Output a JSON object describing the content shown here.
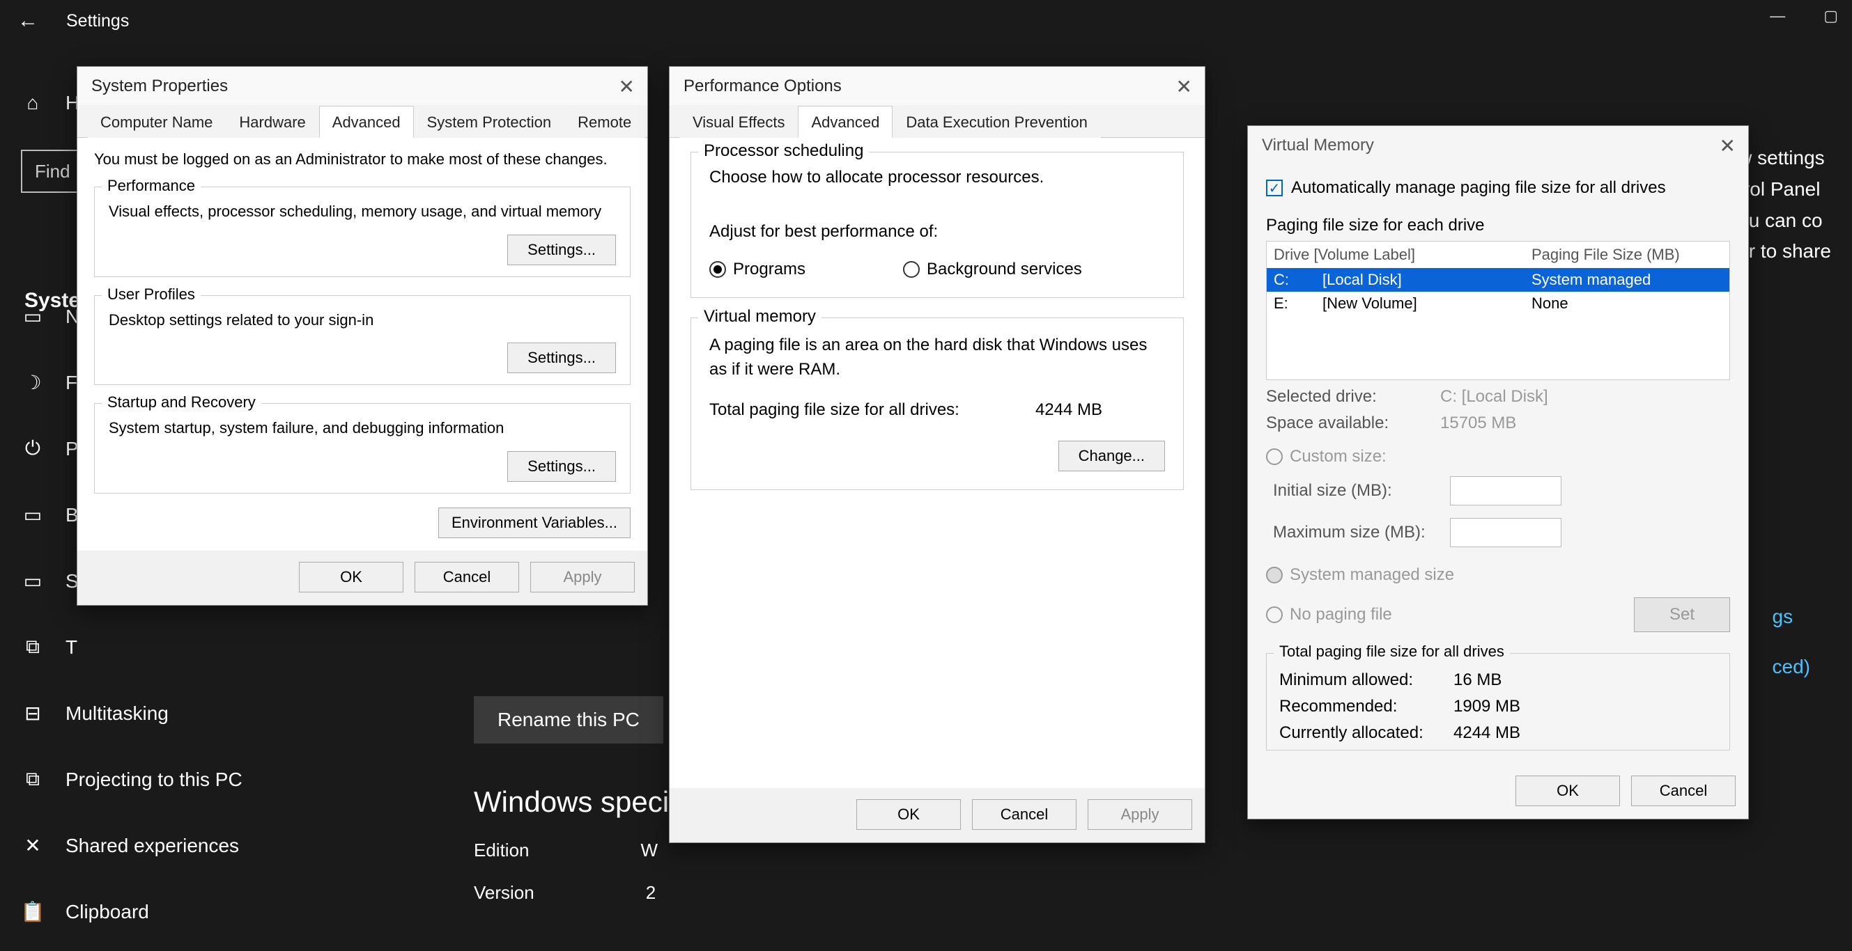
{
  "app": {
    "title": "Settings",
    "search_placeholder": "Find"
  },
  "sidebar": {
    "active_label": "System",
    "items": [
      {
        "icon": "⌂",
        "label": "H"
      },
      {
        "icon": "🔔",
        "label": "N"
      },
      {
        "icon": "☽",
        "label": "F"
      },
      {
        "icon": "⏻",
        "label": "P"
      },
      {
        "icon": "▭",
        "label": "B"
      },
      {
        "icon": "▭",
        "label": "S"
      },
      {
        "icon": "⧉",
        "label": "T"
      },
      {
        "icon": "⊟",
        "label": "Multitasking"
      },
      {
        "icon": "⧉",
        "label": "Projecting to this PC"
      },
      {
        "icon": "✕",
        "label": "Shared experiences"
      },
      {
        "icon": "📋",
        "label": "Clipboard"
      }
    ]
  },
  "main": {
    "rename_label": "Rename this PC",
    "spec_heading": "Windows speci",
    "edition_label": "Edition",
    "edition_value": "W",
    "version_label": "Version",
    "version_value": "2"
  },
  "right_bg": {
    "l1": "w settings",
    "l2": "trol Panel",
    "l3": "ou can co",
    "l4": "er to share",
    "link1": "gs",
    "link2": "ced)"
  },
  "sysprops": {
    "title": "System Properties",
    "tabs": [
      "Computer Name",
      "Hardware",
      "Advanced",
      "System Protection",
      "Remote"
    ],
    "active_tab": 2,
    "admin_note": "You must be logged on as an Administrator to make most of these changes.",
    "perf_label": "Performance",
    "perf_text": "Visual effects, processor scheduling, memory usage, and virtual memory",
    "profiles_label": "User Profiles",
    "profiles_text": "Desktop settings related to your sign-in",
    "startup_label": "Startup and Recovery",
    "startup_text": "System startup, system failure, and debugging information",
    "settings_btn": "Settings...",
    "env_btn": "Environment Variables...",
    "ok": "OK",
    "cancel": "Cancel",
    "apply": "Apply"
  },
  "perfopt": {
    "title": "Performance Options",
    "tabs": [
      "Visual Effects",
      "Advanced",
      "Data Execution Prevention"
    ],
    "active_tab": 1,
    "ps_title": "Processor scheduling",
    "ps_text": "Choose how to allocate processor resources.",
    "adjust_label": "Adjust for best performance of:",
    "radio_programs": "Programs",
    "radio_bg": "Background services",
    "vm_title": "Virtual memory",
    "vm_text": "A paging file is an area on the hard disk that Windows uses as if it were RAM.",
    "total_label": "Total paging file size for all drives:",
    "total_value": "4244 MB",
    "change_btn": "Change...",
    "ok": "OK",
    "cancel": "Cancel",
    "apply": "Apply"
  },
  "vm": {
    "title": "Virtual Memory",
    "auto_label": "Automatically manage paging file size for all drives",
    "each_label": "Paging file size for each drive",
    "head_drive": "Drive  [Volume Label]",
    "head_size": "Paging File Size (MB)",
    "drives": [
      {
        "letter": "C:",
        "label": "[Local Disk]",
        "size": "System managed",
        "selected": true
      },
      {
        "letter": "E:",
        "label": "[New Volume]",
        "size": "None",
        "selected": false
      }
    ],
    "selected_drive_label": "Selected drive:",
    "selected_drive_value": "C:  [Local Disk]",
    "space_label": "Space available:",
    "space_value": "15705 MB",
    "custom_label": "Custom size:",
    "initial_label": "Initial size (MB):",
    "max_label": "Maximum size (MB):",
    "sys_managed_label": "System managed size",
    "no_paging_label": "No paging file",
    "set_btn": "Set",
    "totals_title": "Total paging file size for all drives",
    "min_label": "Minimum allowed:",
    "min_value": "16 MB",
    "rec_label": "Recommended:",
    "rec_value": "1909 MB",
    "cur_label": "Currently allocated:",
    "cur_value": "4244 MB",
    "ok": "OK",
    "cancel": "Cancel"
  }
}
